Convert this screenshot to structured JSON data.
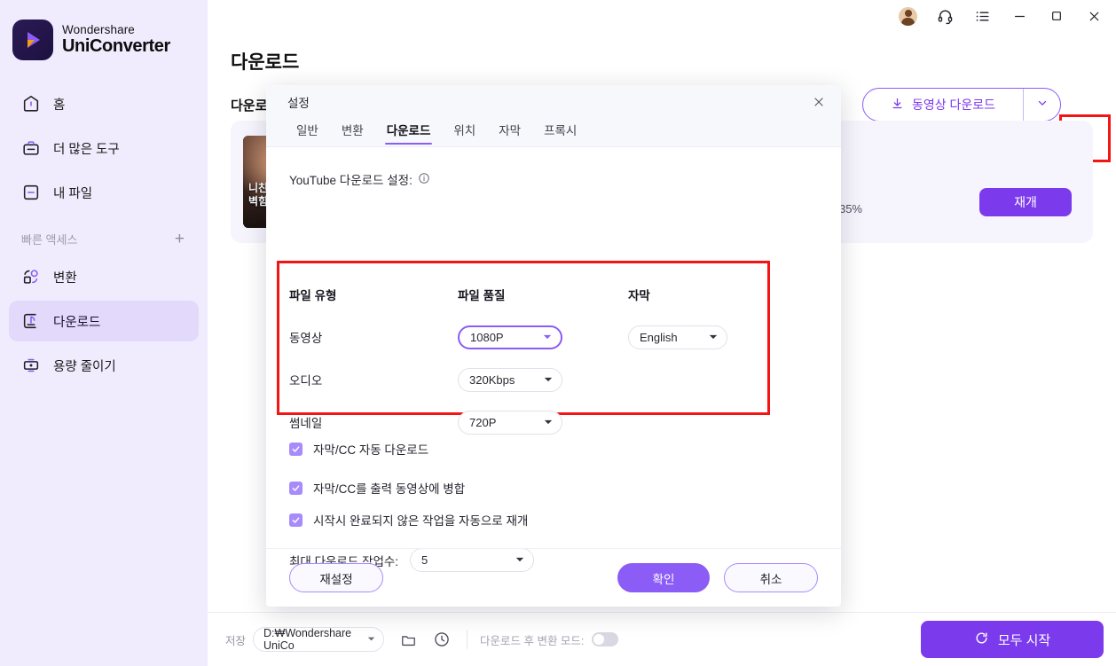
{
  "brand": {
    "top": "Wondershare",
    "bottom": "UniConverter",
    "logo_icon": "uniconverter-logo-icon"
  },
  "sidebar": {
    "items": [
      {
        "label": "홈",
        "icon": "home-icon"
      },
      {
        "label": "더 많은 도구",
        "icon": "toolbox-icon"
      },
      {
        "label": "내 파일",
        "icon": "my-files-icon"
      }
    ],
    "quick_access": {
      "title": "빠른 액세스",
      "add_label": "+"
    },
    "quick_items": [
      {
        "label": "변환",
        "icon": "convert-icon",
        "active": false
      },
      {
        "label": "다운로드",
        "icon": "download-icon",
        "active": true
      },
      {
        "label": "용량 줄이기",
        "icon": "compress-icon",
        "active": false
      }
    ]
  },
  "titlebar": {
    "icons": [
      "account-avatar",
      "headset-icon",
      "menu-list-icon",
      "minimize-icon",
      "maximize-icon",
      "close-icon"
    ]
  },
  "main": {
    "page_title": "다운로드",
    "sub_tab": "다운로드",
    "download_button": {
      "label": "동영상 다운로드",
      "icon": "download-arrow-icon",
      "chevron": "chevron-down-icon"
    },
    "settings_button": {
      "icon": "gear-icon",
      "highlight_color": "#f41414"
    },
    "task": {
      "thumbnail_caption_line1": "니친",
      "thumbnail_caption_line2": "벽힘",
      "progress_percent": "35%",
      "progress_value": 35,
      "resume_label": "재개"
    }
  },
  "bottombar": {
    "save_label": "저장",
    "path_value": "D:₩Wondershare UniCo",
    "folder_icon": "folder-icon",
    "clock_icon": "clock-icon",
    "mode_label": "다운로드 후 변환 모드:",
    "toggle_state": "off",
    "start_all": {
      "label": "모두 시작",
      "icon": "refresh-circle-icon"
    }
  },
  "dialog": {
    "title": "설정",
    "close_icon": "close-icon",
    "tabs": [
      {
        "label": "일반",
        "active": false
      },
      {
        "label": "변환",
        "active": false
      },
      {
        "label": "다운로드",
        "active": true
      },
      {
        "label": "위치",
        "active": false
      },
      {
        "label": "자막",
        "active": false
      },
      {
        "label": "프록시",
        "active": false
      }
    ],
    "youtube_label": "YouTube 다운로드 설정:",
    "info_icon": "info-icon",
    "table": {
      "headers": {
        "type": "파일 유형",
        "quality": "파일 품질",
        "subtitle": "자막"
      },
      "rows": [
        {
          "type": "동영상",
          "quality": "1080P",
          "quality_active": true,
          "subtitle": "English"
        },
        {
          "type": "오디오",
          "quality": "320Kbps",
          "quality_active": false,
          "subtitle": ""
        },
        {
          "type": "썸네일",
          "quality": "720P",
          "quality_active": false,
          "subtitle": ""
        }
      ],
      "highlight_color": "#f41414"
    },
    "checkboxes": [
      {
        "label": "자막/CC 자동 다운로드",
        "checked": true
      },
      {
        "label": "자막/CC를 출력 동영상에 병합",
        "checked": true
      },
      {
        "label": "시작시 완료되지 않은 작업을 자동으로 재개",
        "checked": true
      }
    ],
    "max_downloads": {
      "label": "최대 다운로드 작업수:",
      "value": "5"
    },
    "footer": {
      "reset": "재설정",
      "ok": "확인",
      "cancel": "취소"
    }
  },
  "colors": {
    "accent": "#7c3aed",
    "accent_light": "#8b5cf6",
    "sidebar_bg": "#f0ecfd",
    "highlight": "#f41414"
  }
}
